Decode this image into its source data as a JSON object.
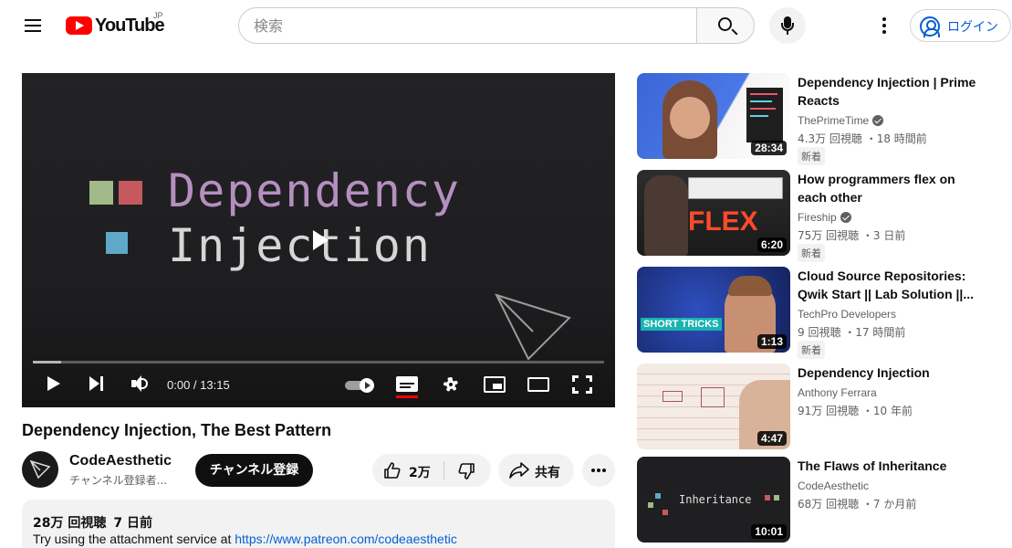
{
  "header": {
    "logo_text": "YouTube",
    "region": "JP",
    "search_placeholder": "検索",
    "signin_label": "ログイン"
  },
  "player": {
    "art_line1": "Dependency",
    "art_line2": "Injection",
    "time": "0:00 / 13:15",
    "progress": 0.0
  },
  "video": {
    "title": "Dependency Injection, The Best Pattern",
    "channel": "CodeAesthetic",
    "subscribers": "チャンネル登録者...",
    "subscribe_label": "チャンネル登録",
    "likes": "2万",
    "share_label": "共有",
    "views": "28万 回視聴",
    "age": "7 日前",
    "desc_text": "Try using the attachment service at ",
    "desc_link": "https://www.patreon.com/codeaesthetic"
  },
  "recommendations": [
    {
      "title": "Dependency Injection | Prime Reacts",
      "channel": "ThePrimeTime",
      "verified": true,
      "meta": "4.3万 回視聴 ・18 時間前",
      "badge": "新着",
      "duration": "28:34",
      "thumb_text": ""
    },
    {
      "title": "How programmers flex on each other",
      "channel": "Fireship",
      "verified": true,
      "meta": "75万 回視聴 ・3 日前",
      "badge": "新着",
      "duration": "6:20",
      "thumb_text": "FLEX"
    },
    {
      "title": "Cloud Source Repositories: Qwik Start || Lab Solution ||...",
      "channel": "TechPro Developers",
      "verified": false,
      "meta": "9 回視聴 ・17 時間前",
      "badge": "新着",
      "duration": "1:13",
      "thumb_text": "SHORT TRICKS"
    },
    {
      "title": "Dependency Injection",
      "channel": "Anthony Ferrara",
      "verified": false,
      "meta": "91万 回視聴 ・10 年前",
      "badge": "",
      "duration": "4:47",
      "thumb_text": ""
    },
    {
      "title": "The Flaws of Inheritance",
      "channel": "CodeAesthetic",
      "verified": false,
      "meta": "68万 回視聴 ・7 か月前",
      "badge": "",
      "duration": "10:01",
      "thumb_text": "Inheritance"
    }
  ],
  "colors": {
    "accent": "#ff0000",
    "link": "#065fd4",
    "sq_green": "#a2b98a",
    "sq_red": "#c5595e",
    "sq_blue": "#5fa8c7"
  }
}
